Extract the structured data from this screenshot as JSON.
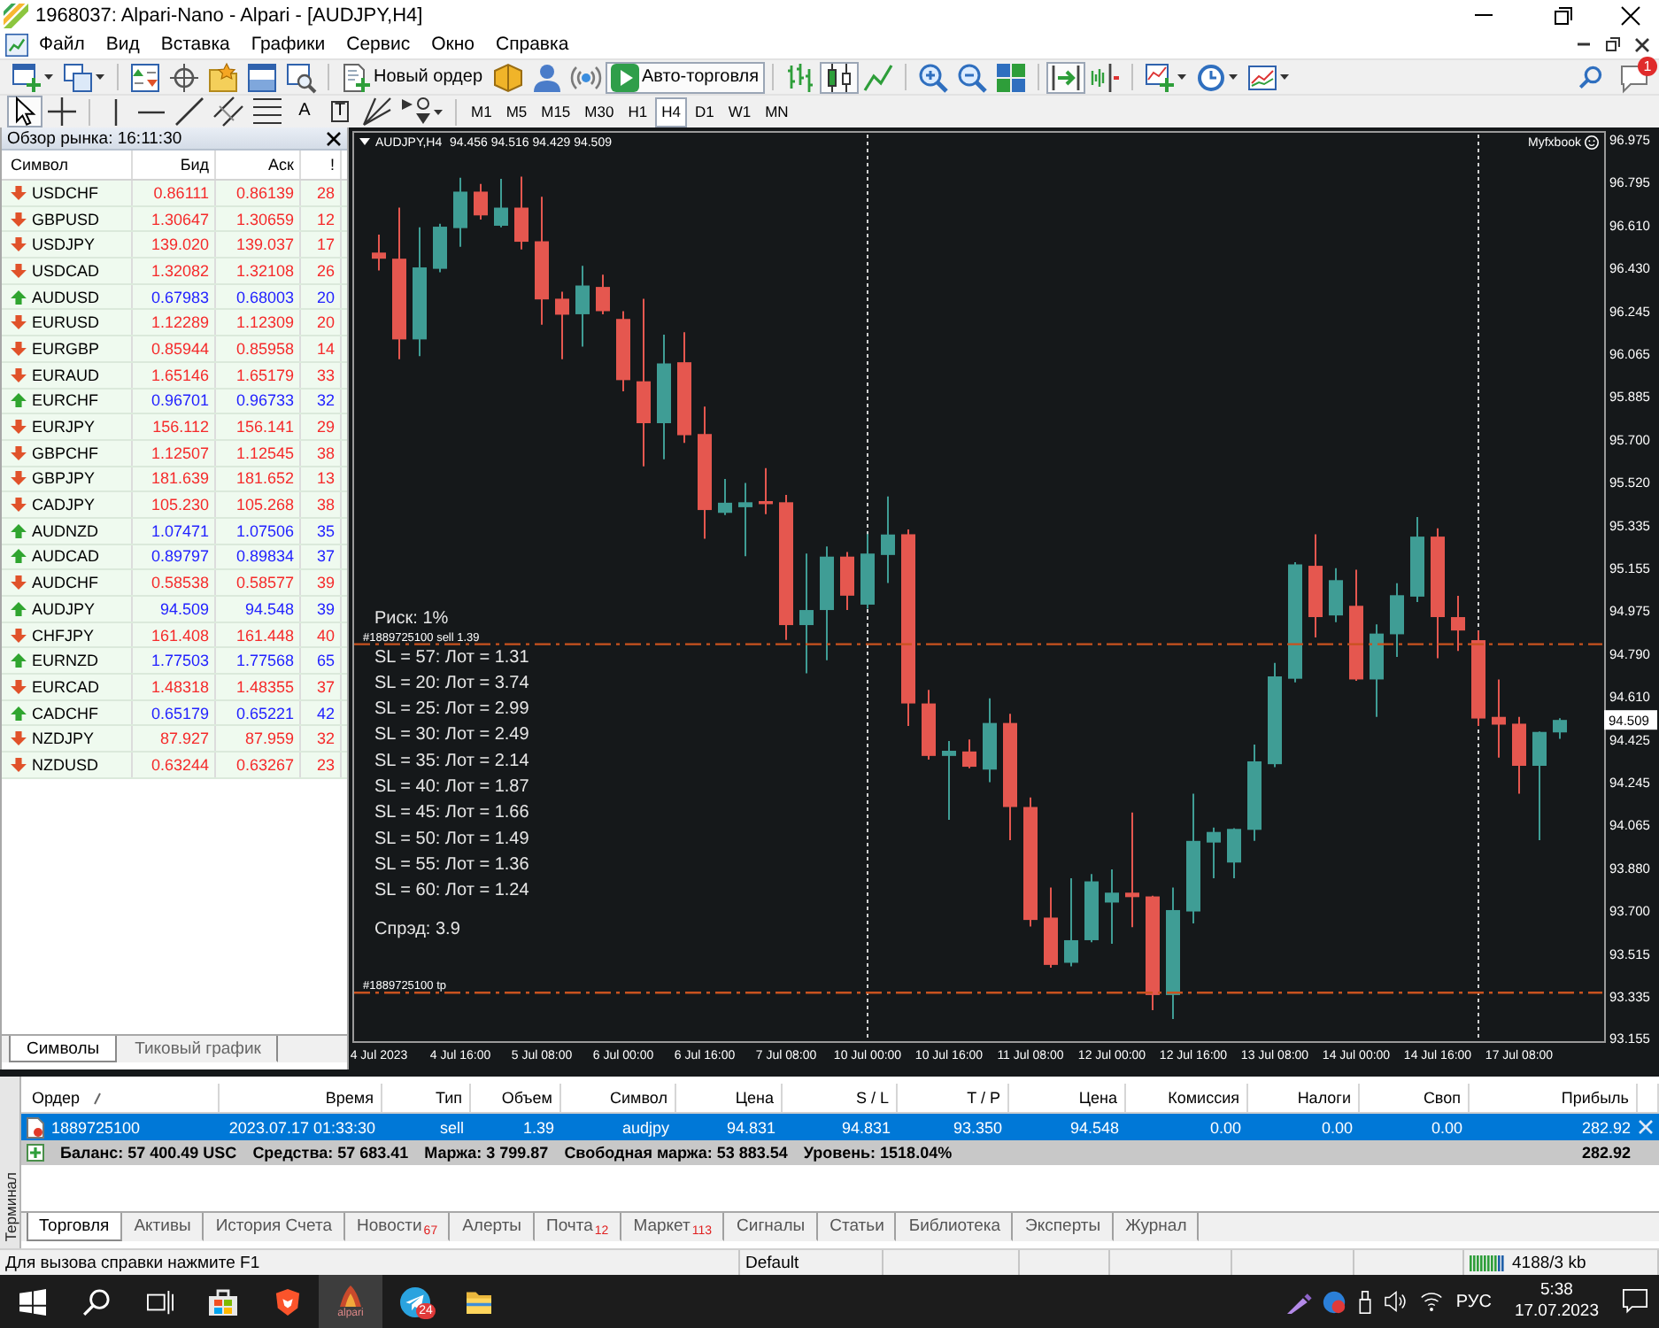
{
  "window": {
    "title": "1968037: Alpari-Nano - Alpari - [AUDJPY,H4]"
  },
  "menu": {
    "items": [
      "Файл",
      "Вид",
      "Вставка",
      "Графики",
      "Сервис",
      "Окно",
      "Справка"
    ]
  },
  "toolbar": {
    "groups": [
      [
        {
          "kind": "newchart",
          "pressed": false
        },
        {
          "kind": "profiles",
          "pressed": false
        }
      ],
      [
        {
          "kind": "marketwatch",
          "pressed": false
        },
        {
          "kind": "datawindow",
          "pressed": false
        },
        {
          "kind": "navigator",
          "pressed": false
        },
        {
          "kind": "terminal",
          "pressed": false
        },
        {
          "kind": "tester",
          "pressed": false
        }
      ],
      [
        {
          "kind": "neworder",
          "label": "Новый ордер",
          "pressed": false
        },
        {
          "kind": "editor",
          "pressed": false
        },
        {
          "kind": "community",
          "pressed": false
        },
        {
          "kind": "signals",
          "pressed": false
        },
        {
          "kind": "autotrading",
          "label": "Авто-торговля",
          "pressed": true
        }
      ],
      [
        {
          "kind": "bars",
          "pressed": false
        },
        {
          "kind": "candles",
          "pressed": true
        },
        {
          "kind": "line",
          "pressed": false
        }
      ],
      [
        {
          "kind": "zoomin",
          "pressed": false
        },
        {
          "kind": "zoomout",
          "pressed": false
        },
        {
          "kind": "tile",
          "pressed": false
        }
      ],
      [
        {
          "kind": "autoscroll",
          "pressed": true
        },
        {
          "kind": "shift",
          "pressed": false
        }
      ],
      [
        {
          "kind": "indicators",
          "pressed": false
        },
        {
          "kind": "periods",
          "pressed": false
        },
        {
          "kind": "templates",
          "pressed": false
        }
      ]
    ],
    "notifications": "1"
  },
  "drawing": {
    "tools": [
      {
        "kind": "cursor",
        "pressed": true
      },
      {
        "kind": "crosshair",
        "pressed": false
      }
    ],
    "objects": [
      {
        "kind": "vline",
        "pressed": false
      },
      {
        "kind": "hline",
        "pressed": false
      },
      {
        "kind": "trend",
        "pressed": false
      },
      {
        "kind": "channel",
        "pressed": false
      },
      {
        "kind": "fibo",
        "pressed": false
      },
      {
        "kind": "text",
        "glyph": "A",
        "pressed": false
      },
      {
        "kind": "label",
        "glyph": "T",
        "pressed": false
      },
      {
        "kind": "fan",
        "pressed": false
      },
      {
        "kind": "arrows",
        "pressed": false
      }
    ],
    "timeframes": [
      {
        "label": "M1",
        "selected": false
      },
      {
        "label": "M5",
        "selected": false
      },
      {
        "label": "M15",
        "selected": false
      },
      {
        "label": "M30",
        "selected": false
      },
      {
        "label": "H1",
        "selected": false
      },
      {
        "label": "H4",
        "selected": true
      },
      {
        "label": "D1",
        "selected": false
      },
      {
        "label": "W1",
        "selected": false
      },
      {
        "label": "MN",
        "selected": false
      }
    ]
  },
  "market_watch": {
    "title": "Обзор рынка: 16:11:30",
    "columns": [
      "Символ",
      "Бид",
      "Аск",
      "!"
    ],
    "rows": [
      {
        "symbol": "USDCHF",
        "bid": "0.86111",
        "ask": "0.86139",
        "spread": "28",
        "rising": false
      },
      {
        "symbol": "GBPUSD",
        "bid": "1.30647",
        "ask": "1.30659",
        "spread": "12",
        "rising": false
      },
      {
        "symbol": "USDJPY",
        "bid": "139.020",
        "ask": "139.037",
        "spread": "17",
        "rising": false
      },
      {
        "symbol": "USDCAD",
        "bid": "1.32082",
        "ask": "1.32108",
        "spread": "26",
        "rising": false
      },
      {
        "symbol": "AUDUSD",
        "bid": "0.67983",
        "ask": "0.68003",
        "spread": "20",
        "rising": true
      },
      {
        "symbol": "EURUSD",
        "bid": "1.12289",
        "ask": "1.12309",
        "spread": "20",
        "rising": false
      },
      {
        "symbol": "EURGBP",
        "bid": "0.85944",
        "ask": "0.85958",
        "spread": "14",
        "rising": false
      },
      {
        "symbol": "EURAUD",
        "bid": "1.65146",
        "ask": "1.65179",
        "spread": "33",
        "rising": false
      },
      {
        "symbol": "EURCHF",
        "bid": "0.96701",
        "ask": "0.96733",
        "spread": "32",
        "rising": true
      },
      {
        "symbol": "EURJPY",
        "bid": "156.112",
        "ask": "156.141",
        "spread": "29",
        "rising": false
      },
      {
        "symbol": "GBPCHF",
        "bid": "1.12507",
        "ask": "1.12545",
        "spread": "38",
        "rising": false
      },
      {
        "symbol": "GBPJPY",
        "bid": "181.639",
        "ask": "181.652",
        "spread": "13",
        "rising": false
      },
      {
        "symbol": "CADJPY",
        "bid": "105.230",
        "ask": "105.268",
        "spread": "38",
        "rising": false
      },
      {
        "symbol": "AUDNZD",
        "bid": "1.07471",
        "ask": "1.07506",
        "spread": "35",
        "rising": true
      },
      {
        "symbol": "AUDCAD",
        "bid": "0.89797",
        "ask": "0.89834",
        "spread": "37",
        "rising": true
      },
      {
        "symbol": "AUDCHF",
        "bid": "0.58538",
        "ask": "0.58577",
        "spread": "39",
        "rising": false
      },
      {
        "symbol": "AUDJPY",
        "bid": "94.509",
        "ask": "94.548",
        "spread": "39",
        "rising": true
      },
      {
        "symbol": "CHFJPY",
        "bid": "161.408",
        "ask": "161.448",
        "spread": "40",
        "rising": false
      },
      {
        "symbol": "EURNZD",
        "bid": "1.77503",
        "ask": "1.77568",
        "spread": "65",
        "rising": true
      },
      {
        "symbol": "EURCAD",
        "bid": "1.48318",
        "ask": "1.48355",
        "spread": "37",
        "rising": false
      },
      {
        "symbol": "CADCHF",
        "bid": "0.65179",
        "ask": "0.65221",
        "spread": "42",
        "rising": true
      },
      {
        "symbol": "NZDJPY",
        "bid": "87.927",
        "ask": "87.959",
        "spread": "32",
        "rising": false
      },
      {
        "symbol": "NZDUSD",
        "bid": "0.63244",
        "ask": "0.63267",
        "spread": "23",
        "rising": false
      }
    ],
    "tabs": [
      {
        "label": "Символы",
        "selected": true
      },
      {
        "label": "Тиковый график",
        "selected": false
      }
    ]
  },
  "chart": {
    "symbol": "AUDJPY,H4",
    "ohlc_readout": "94.456 94.516 94.429 94.509",
    "brand": "Myfxbook",
    "current_price": "94.509",
    "risk": "Риск: 1%",
    "lot_table": [
      "SL = 57: Лот = 1.31",
      "SL = 20: Лот = 3.74",
      "SL = 25: Лот = 2.99",
      "SL = 30: Лот = 2.49",
      "SL = 35: Лот = 2.14",
      "SL = 40: Лот = 1.87",
      "SL = 45: Лот = 1.66",
      "SL = 50: Лот = 1.49",
      "SL = 55: Лот = 1.36",
      "SL = 60: Лот = 1.24"
    ],
    "spread": "Спрэд: 3.9",
    "chart_data": {
      "type": "candlestick",
      "categories": [
        "4 Jul 2023",
        null,
        null,
        null,
        "4 Jul 16:00",
        null,
        null,
        null,
        "5 Jul 08:00",
        null,
        null,
        null,
        "6 Jul 00:00",
        null,
        null,
        null,
        "6 Jul 16:00",
        null,
        null,
        null,
        "7 Jul 08:00",
        null,
        null,
        null,
        "10 Jul 00:00",
        null,
        null,
        null,
        "10 Jul 16:00",
        null,
        null,
        null,
        "11 Jul 08:00",
        null,
        null,
        null,
        "12 Jul 00:00",
        null,
        null,
        null,
        "12 Jul 16:00",
        null,
        null,
        null,
        "13 Jul 08:00",
        null,
        null,
        null,
        "14 Jul 00:00",
        null,
        null,
        null,
        "14 Jul 16:00",
        null,
        null,
        null,
        "17 Jul 08:00",
        null,
        null
      ],
      "ohlc": [
        [
          96.495,
          96.571,
          96.419,
          96.469
        ],
        [
          96.469,
          96.686,
          96.042,
          96.126
        ],
        [
          96.126,
          96.602,
          96.055,
          96.432
        ],
        [
          96.426,
          96.617,
          96.411,
          96.605
        ],
        [
          96.599,
          96.813,
          96.52,
          96.754
        ],
        [
          96.754,
          96.787,
          96.635,
          96.653
        ],
        [
          96.609,
          96.808,
          96.602,
          96.686
        ],
        [
          96.686,
          96.818,
          96.508,
          96.541
        ],
        [
          96.543,
          96.732,
          96.189,
          96.296
        ],
        [
          96.299,
          96.329,
          96.042,
          96.231
        ],
        [
          96.233,
          96.439,
          96.095,
          96.355
        ],
        [
          96.349,
          96.401,
          96.233,
          96.246
        ],
        [
          96.213,
          96.246,
          95.905,
          95.953
        ],
        [
          95.948,
          96.299,
          95.587,
          95.77
        ],
        [
          95.77,
          96.146,
          95.617,
          96.024
        ],
        [
          96.029,
          96.157,
          95.686,
          95.719
        ],
        [
          95.724,
          95.841,
          95.279,
          95.401
        ],
        [
          95.389,
          95.533,
          95.38,
          95.432
        ],
        [
          95.413,
          95.516,
          95.205,
          95.434
        ],
        [
          95.439,
          95.579,
          95.383,
          95.426
        ],
        [
          95.434,
          95.465,
          94.849,
          94.912
        ],
        [
          94.912,
          95.216,
          94.707,
          94.976
        ],
        [
          94.976,
          95.246,
          94.763,
          95.203
        ],
        [
          95.203,
          95.223,
          94.976,
          95.037
        ],
        [
          94.999,
          95.299,
          94.982,
          95.216
        ],
        [
          95.21,
          95.459,
          95.091,
          95.297
        ],
        [
          95.298,
          95.319,
          94.483,
          94.579
        ],
        [
          94.579,
          94.637,
          94.34,
          94.356
        ],
        [
          94.356,
          94.419,
          94.085,
          94.378
        ],
        [
          94.375,
          94.426,
          94.304,
          94.31
        ],
        [
          94.298,
          94.601,
          94.244,
          94.496
        ],
        [
          94.496,
          94.535,
          93.998,
          94.139
        ],
        [
          94.139,
          94.18,
          93.631,
          93.659
        ],
        [
          93.669,
          93.797,
          93.456,
          93.468
        ],
        [
          93.477,
          93.836,
          93.462,
          93.573
        ],
        [
          93.573,
          93.854,
          93.564,
          93.823
        ],
        [
          93.733,
          93.874,
          93.558,
          93.775
        ],
        [
          93.775,
          94.116,
          93.628,
          93.756
        ],
        [
          93.759,
          93.762,
          93.276,
          93.34
        ],
        [
          93.34,
          93.797,
          93.238,
          93.701
        ],
        [
          93.695,
          94.196,
          93.644,
          93.995
        ],
        [
          93.988,
          94.052,
          93.836,
          94.033
        ],
        [
          93.903,
          94.049,
          93.836,
          94.046
        ],
        [
          94.042,
          94.404,
          93.995,
          94.333
        ],
        [
          94.321,
          94.751,
          94.308,
          94.694
        ],
        [
          94.684,
          95.179,
          94.669,
          95.17
        ],
        [
          95.164,
          95.298,
          94.86,
          94.946
        ],
        [
          94.953,
          95.154,
          94.924,
          95.103
        ],
        [
          94.994,
          95.147,
          94.675,
          94.681
        ],
        [
          94.681,
          94.915,
          94.522,
          94.876
        ],
        [
          94.873,
          95.09,
          94.777,
          95.039
        ],
        [
          95.033,
          95.371,
          95.01,
          95.288
        ],
        [
          95.288,
          95.323,
          94.771,
          94.946
        ],
        [
          94.946,
          95.036,
          94.802,
          94.889
        ],
        [
          94.848,
          94.889,
          94.483,
          94.515
        ],
        [
          94.522,
          94.681,
          94.349,
          94.489
        ],
        [
          94.493,
          94.522,
          94.196,
          94.314
        ],
        [
          94.314,
          94.46,
          93.998,
          94.458
        ],
        [
          94.456,
          94.516,
          94.429,
          94.509
        ]
      ],
      "ylim": [
        93.144,
        97.004
      ],
      "yticks": [
        {
          "value": 96.975,
          "label": "96.975"
        },
        {
          "value": 96.795,
          "label": "96.795"
        },
        {
          "value": 96.61,
          "label": "96.610"
        },
        {
          "value": 96.43,
          "label": "96.430"
        },
        {
          "value": 96.245,
          "label": "96.245"
        },
        {
          "value": 96.065,
          "label": "96.065"
        },
        {
          "value": 95.885,
          "label": "95.885"
        },
        {
          "value": 95.7,
          "label": "95.700"
        },
        {
          "value": 95.52,
          "label": "95.520"
        },
        {
          "value": 95.335,
          "label": "95.335"
        },
        {
          "value": 95.155,
          "label": "95.155"
        },
        {
          "value": 94.975,
          "label": "94.975"
        },
        {
          "value": 94.79,
          "label": "94.790"
        },
        {
          "value": 94.61,
          "label": "94.610"
        },
        {
          "value": 94.425,
          "label": "94.425"
        },
        {
          "value": 94.245,
          "label": "94.245"
        },
        {
          "value": 94.065,
          "label": "94.065"
        },
        {
          "value": 93.88,
          "label": "93.880"
        },
        {
          "value": 93.7,
          "label": "93.700"
        },
        {
          "value": 93.515,
          "label": "93.515"
        },
        {
          "value": 93.335,
          "label": "93.335"
        },
        {
          "value": 93.155,
          "label": "93.155"
        }
      ],
      "ref_lines": [
        {
          "axis": "y",
          "value": 94.831,
          "label": "#1889725100 sell 1.39"
        },
        {
          "axis": "y",
          "value": 93.35,
          "label": "#1889725100 tp"
        }
      ]
    }
  },
  "terminal": {
    "side_label": "Терминал",
    "columns": [
      {
        "label": "Ордер",
        "sorted": true
      },
      {
        "label": "Время",
        "sorted": false
      },
      {
        "label": "Тип",
        "sorted": false
      },
      {
        "label": "Объем",
        "sorted": false
      },
      {
        "label": "Символ",
        "sorted": false
      },
      {
        "label": "Цена",
        "sorted": false
      },
      {
        "label": "S / L",
        "sorted": false
      },
      {
        "label": "T / P",
        "sorted": false
      },
      {
        "label": "Цена",
        "sorted": false
      },
      {
        "label": "Комиссия",
        "sorted": false
      },
      {
        "label": "Налоги",
        "sorted": false
      },
      {
        "label": "Своп",
        "sorted": false
      },
      {
        "label": "Прибыль",
        "sorted": false
      }
    ],
    "orders": [
      {
        "cells": [
          "1889725100",
          "2023.07.17 01:33:30",
          "sell",
          "1.39",
          "audjpy",
          "94.831",
          "94.831",
          "93.350",
          "94.548",
          "0.00",
          "0.00",
          "0.00",
          "282.92"
        ],
        "selected": true
      }
    ],
    "summary": {
      "items": [
        "Баланс: 57 400.49 USC",
        "Средства: 57 683.41",
        "Маржа: 3 799.87",
        "Свободная маржа: 53 883.54",
        "Уровень: 1518.04%"
      ],
      "profit": "282.92"
    },
    "tabs": [
      {
        "label": "Торговля",
        "selected": true
      },
      {
        "label": "Активы",
        "selected": false
      },
      {
        "label": "История Счета",
        "selected": false
      },
      {
        "label": "Новости",
        "count": "67",
        "selected": false
      },
      {
        "label": "Алерты",
        "selected": false
      },
      {
        "label": "Почта",
        "count": "12",
        "selected": false
      },
      {
        "label": "Маркет",
        "count": "113",
        "selected": false
      },
      {
        "label": "Сигналы",
        "selected": false
      },
      {
        "label": "Статьи",
        "selected": false
      },
      {
        "label": "Библиотека",
        "selected": false
      },
      {
        "label": "Эксперты",
        "selected": false
      },
      {
        "label": "Журнал",
        "selected": false
      }
    ]
  },
  "status_bar": {
    "help": "Для вызова справки нажмите F1",
    "profile": "Default",
    "traffic": "4188/3 kb"
  },
  "taskbar": {
    "apps": [
      {
        "kind": "start",
        "active": false
      },
      {
        "kind": "search",
        "active": false
      },
      {
        "kind": "taskview",
        "active": false
      },
      {
        "kind": "store",
        "active": false
      },
      {
        "kind": "brave",
        "active": false
      },
      {
        "kind": "alpari",
        "label": "alpari",
        "active": true
      },
      {
        "kind": "telegram",
        "badge": "24",
        "active": false
      },
      {
        "kind": "explorer",
        "active": false
      }
    ],
    "tray": {
      "language": "РУС",
      "time": "5:38",
      "date": "17.07.2023"
    }
  }
}
